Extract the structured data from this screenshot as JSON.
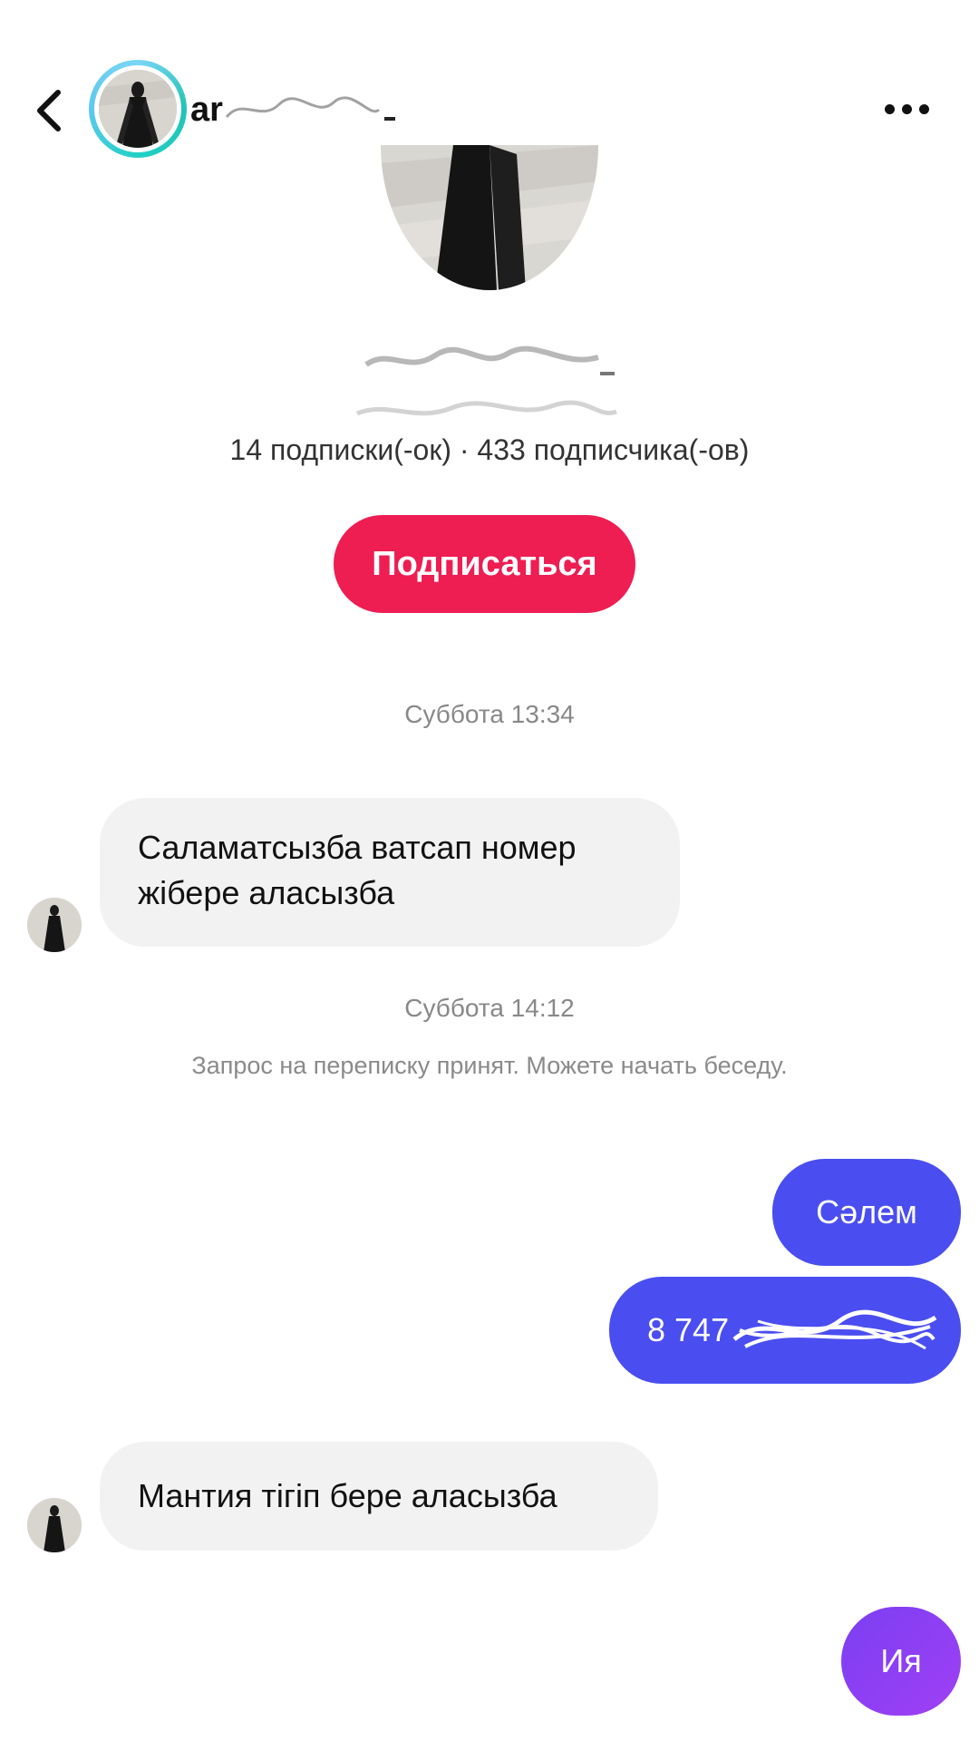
{
  "header": {
    "username": "ar",
    "back_icon": "chevron-left-icon",
    "more_icon": "more-horizontal-icon"
  },
  "profile": {
    "stats": "14 подписки(-ок) · 433 подписчика(-ов)",
    "follow_label": "Подписаться",
    "follow_color": "#ee1d52"
  },
  "chat": {
    "timestamp_1": "Суббота 13:34",
    "msg_in_1": "Саламатсызба ватсап номер жібере аласызба",
    "timestamp_2": "Суббота 14:12",
    "system_msg": "Запрос на переписку принят. Можете начать беседу.",
    "msg_out_1": "Сәлем",
    "msg_out_2": "8 747",
    "msg_in_2": "Мантия тігіп бере аласызба",
    "msg_out_3": "Ия",
    "out_color": "#4a4ef0",
    "out_color_last": "#8a3ff5"
  }
}
